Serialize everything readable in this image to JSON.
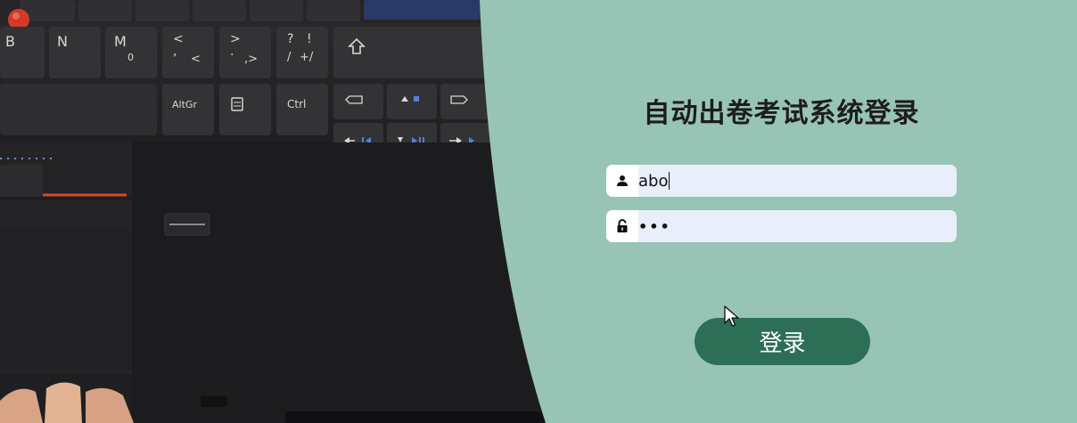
{
  "login": {
    "title": "自动出卷考试系统登录",
    "username_value": "abo",
    "password_value": "•••",
    "submit_label": "登录"
  },
  "keyboard": {
    "row1": [
      "B",
      "N",
      "M",
      "<",
      ">",
      "?",
      "⇧"
    ],
    "m_sub": "0",
    "lt_sub": ",",
    "gt_sub": ".",
    "q_sub": "/",
    "q_alt": "!",
    "q_sub2": "+/",
    "lt_alt": "<",
    "gt_alt": ",>",
    "altgr": "AltGr",
    "ctrl": "Ctrl"
  },
  "icons": {
    "username": "user-icon",
    "password": "lock-icon",
    "pointer": "mouse-cursor-icon"
  },
  "colors": {
    "panel_bg": "#98c4b5",
    "button_bg": "#2d6e56",
    "field_bg": "#e8eefa"
  }
}
